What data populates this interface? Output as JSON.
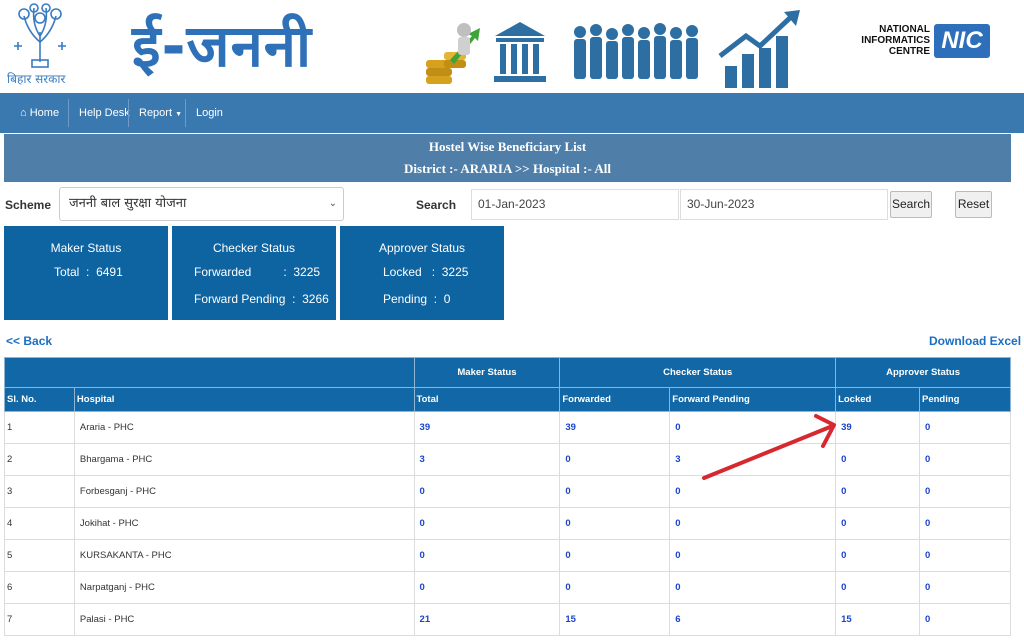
{
  "header": {
    "emblem_caption": "बिहार सरकार",
    "brand_title": "ई-जननी",
    "nic_text_lines": [
      "NATIONAL",
      "INFORMATICS",
      "CENTRE"
    ],
    "nic_logo_text": "NIC"
  },
  "navbar": {
    "items": [
      {
        "label": "Home",
        "icon": "home-icon"
      },
      {
        "label": "Help Desk"
      },
      {
        "label": "Report",
        "icon": "caret-down-icon"
      },
      {
        "label": "Login"
      }
    ]
  },
  "title": {
    "line1": "Hostel Wise Beneficiary List",
    "line2": "District :- ARARIA >> Hospital :- All"
  },
  "filters": {
    "scheme_label": "Scheme",
    "scheme_value": "जननी बाल सुरक्षा योजना",
    "search_label": "Search",
    "from_date": "01-Jan-2023",
    "to_date": "30-Jun-2023",
    "search_button": "Search",
    "reset_button": "Reset"
  },
  "status_cards": {
    "maker": {
      "title": "Maker Status",
      "total_label": "Total",
      "total_value": "6491"
    },
    "checker": {
      "title": "Checker Status",
      "forwarded_label": "Forwarded",
      "forwarded_value": "3225",
      "pending_label": "Forward Pending",
      "pending_value": "3266"
    },
    "approver": {
      "title": "Approver Status",
      "locked_label": "Locked",
      "locked_value": "3225",
      "pending_label": "Pending",
      "pending_value": "0"
    }
  },
  "links": {
    "back": "<< Back",
    "download": "Download Excel"
  },
  "table": {
    "group_headers": [
      "Maker Status",
      "Checker Status",
      "Approver Status"
    ],
    "columns": [
      "Sl. No.",
      "Hospital",
      "Total",
      "Forwarded",
      "Forward Pending",
      "Locked",
      "Pending"
    ],
    "rows": [
      [
        "1",
        "Araria - PHC",
        "39",
        "39",
        "0",
        "39",
        "0"
      ],
      [
        "2",
        "Bhargama - PHC",
        "3",
        "0",
        "3",
        "0",
        "0"
      ],
      [
        "3",
        "Forbesganj - PHC",
        "0",
        "0",
        "0",
        "0",
        "0"
      ],
      [
        "4",
        "Jokihat - PHC",
        "0",
        "0",
        "0",
        "0",
        "0"
      ],
      [
        "5",
        "KURSAKANTA - PHC",
        "0",
        "0",
        "0",
        "0",
        "0"
      ],
      [
        "6",
        "Narpatganj - PHC",
        "0",
        "0",
        "0",
        "0",
        "0"
      ],
      [
        "7",
        "Palasi - PHC",
        "21",
        "15",
        "6",
        "15",
        "0"
      ]
    ]
  },
  "colors": {
    "navbar": "#3a78b0",
    "card": "#0e63a1",
    "table_header": "#1268a6",
    "link": "#1b6ec2",
    "annotation_arrow": "#d8282f"
  }
}
